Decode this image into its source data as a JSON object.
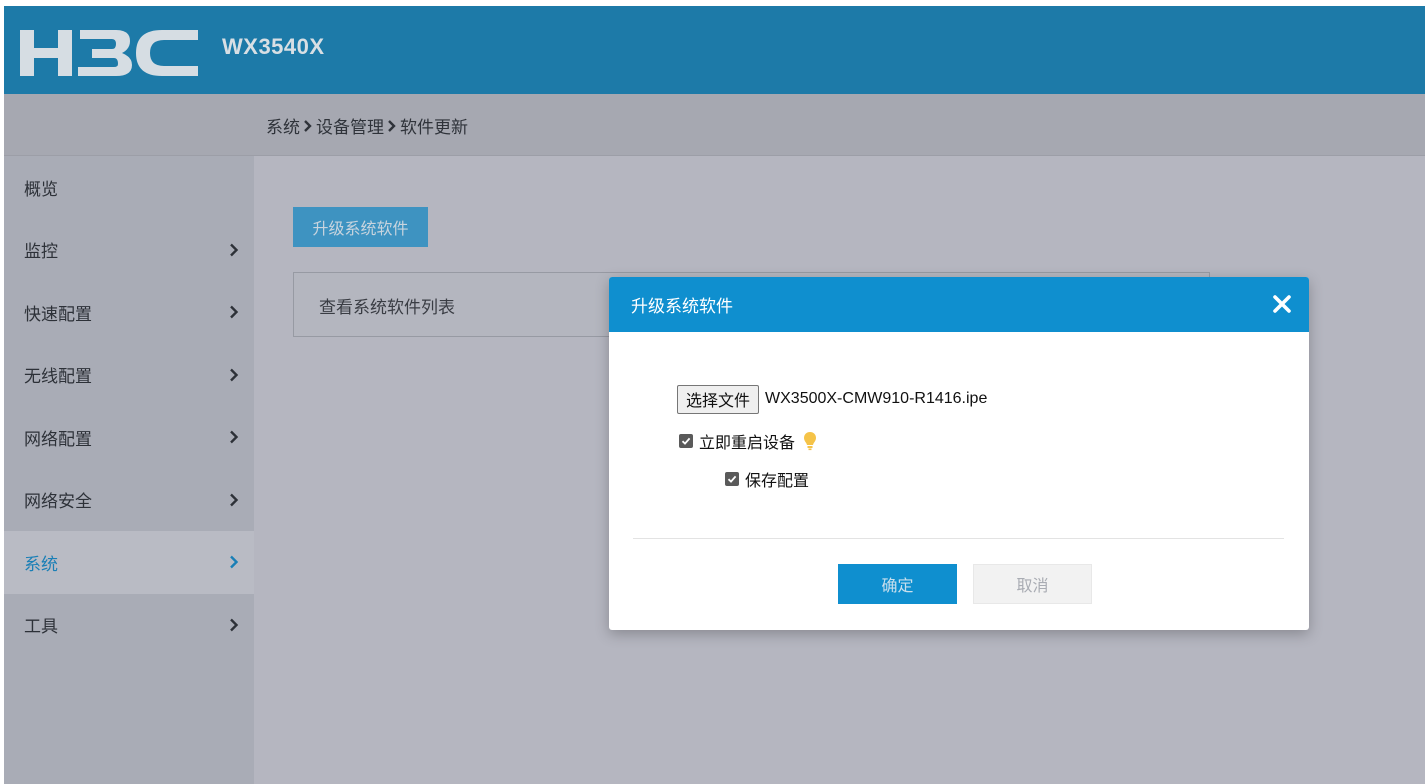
{
  "header": {
    "brand": "H3C",
    "model": "WX3540X"
  },
  "breadcrumb": [
    "系统",
    "设备管理",
    "软件更新"
  ],
  "sidebar": {
    "items": [
      {
        "label": "概览",
        "has_arrow": false,
        "active": false
      },
      {
        "label": "监控",
        "has_arrow": true,
        "active": false
      },
      {
        "label": "快速配置",
        "has_arrow": true,
        "active": false
      },
      {
        "label": "无线配置",
        "has_arrow": true,
        "active": false
      },
      {
        "label": "网络配置",
        "has_arrow": true,
        "active": false
      },
      {
        "label": "网络安全",
        "has_arrow": true,
        "active": false
      },
      {
        "label": "系统",
        "has_arrow": true,
        "active": true
      },
      {
        "label": "工具",
        "has_arrow": true,
        "active": false
      }
    ]
  },
  "main": {
    "upgrade_button_label": "升级系统软件",
    "panel_title": "查看系统软件列表"
  },
  "modal": {
    "title": "升级系统软件",
    "choose_file_label": "选择文件",
    "file_name": "WX3500X-CMW910-R1416.ipe",
    "reboot_label": "立即重启设备",
    "reboot_checked": true,
    "save_config_label": "保存配置",
    "save_config_checked": true,
    "ok_label": "确定",
    "cancel_label": "取消"
  },
  "colors": {
    "header_bg": "#1d7aa8",
    "accent": "#0f8fcf",
    "active_nav_text": "#1a7fb6",
    "hint_bulb": "#f5c348"
  },
  "icons": {
    "close": "close-icon",
    "nav_arrow": "chevron-right-icon",
    "hint": "lightbulb-icon"
  }
}
